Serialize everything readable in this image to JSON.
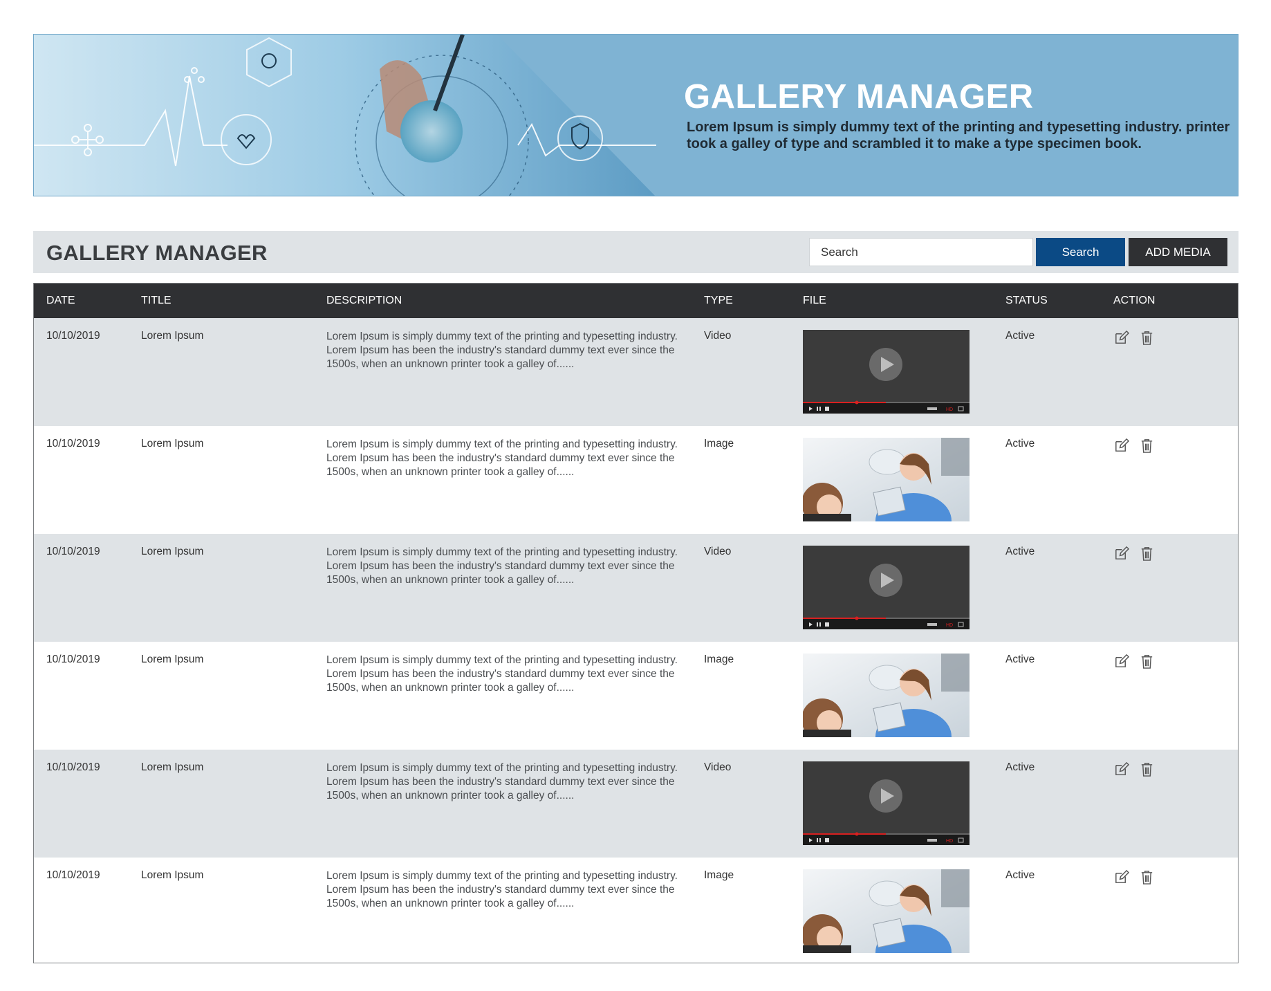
{
  "banner": {
    "title": "GALLERY MANAGER",
    "subtitle": "Lorem Ipsum is simply dummy text of the printing and typesetting industry. printer took a galley of type and scrambled it to make a type specimen book."
  },
  "toolbar": {
    "title": "GALLERY MANAGER",
    "search_placeholder": "Search",
    "search_button": "Search",
    "add_button": "ADD MEDIA"
  },
  "table": {
    "headers": [
      "DATE",
      "TITLE",
      "DESCRIPTION",
      "TYPE",
      "FILE",
      "STATUS",
      "ACTION"
    ],
    "rows": [
      {
        "date": "10/10/2019",
        "title": "Lorem Ipsum",
        "description": "Lorem Ipsum is simply dummy text of the printing and typesetting industry. Lorem Ipsum has been the industry's standard dummy text ever since the 1500s, when an unknown printer took a galley of......",
        "type": "Video",
        "file": "video-thumbnail",
        "status": "Active"
      },
      {
        "date": "10/10/2019",
        "title": "Lorem Ipsum",
        "description": "Lorem Ipsum is simply dummy text of the printing and typesetting industry. Lorem Ipsum has been the industry's standard dummy text ever since the 1500s, when an unknown printer took a galley of......",
        "type": "Image",
        "file": "image-thumbnail",
        "status": "Active"
      },
      {
        "date": "10/10/2019",
        "title": "Lorem Ipsum",
        "description": "Lorem Ipsum is simply dummy text of the printing and typesetting industry. Lorem Ipsum has been the industry's standard dummy text ever since the 1500s, when an unknown printer took a galley of......",
        "type": "Video",
        "file": "video-thumbnail",
        "status": "Active"
      },
      {
        "date": "10/10/2019",
        "title": "Lorem Ipsum",
        "description": "Lorem Ipsum is simply dummy text of the printing and typesetting industry. Lorem Ipsum has been the industry's standard dummy text ever since the 1500s, when an unknown printer took a galley of......",
        "type": "Image",
        "file": "image-thumbnail",
        "status": "Active"
      },
      {
        "date": "10/10/2019",
        "title": "Lorem Ipsum",
        "description": "Lorem Ipsum is simply dummy text of the printing and typesetting industry. Lorem Ipsum has been the industry's standard dummy text ever since the 1500s, when an unknown printer took a galley of......",
        "type": "Video",
        "file": "video-thumbnail",
        "status": "Active"
      },
      {
        "date": "10/10/2019",
        "title": "Lorem Ipsum",
        "description": "Lorem Ipsum is simply dummy text of the printing and typesetting industry. Lorem Ipsum has been the industry's standard dummy text ever since the 1500s, when an unknown printer took a galley of......",
        "type": "Image",
        "file": "image-thumbnail",
        "status": "Active"
      }
    ]
  },
  "icons": {
    "edit": "edit-icon",
    "delete": "trash-icon",
    "play": "play-icon"
  },
  "colors": {
    "banner_bg": "#7fb3d3",
    "toolbar_bg": "#dfe3e6",
    "primary_button": "#0b4a85",
    "dark_button": "#2f3033",
    "table_header": "#2f3033"
  }
}
